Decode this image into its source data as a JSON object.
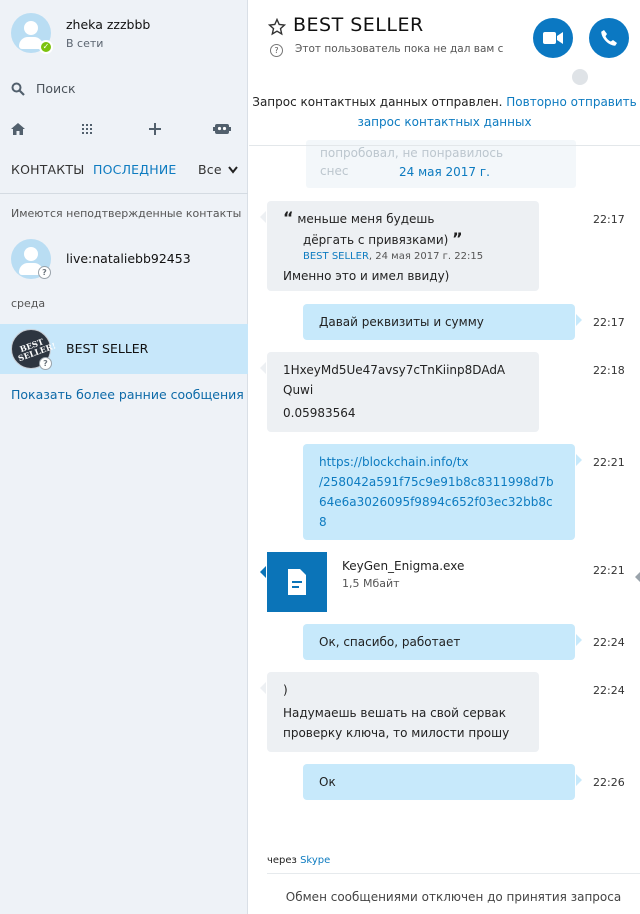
{
  "profile": {
    "name": "zheka zzzbbb",
    "status": "В сети"
  },
  "search": {
    "label": "Поиск"
  },
  "toolbar": {
    "home": "home-icon",
    "dialpad": "dialpad-icon",
    "add": "add-icon",
    "bot": "bot-icon"
  },
  "tabs": {
    "contacts": "КОНТАКТЫ",
    "recent": "ПОСЛЕДНИЕ",
    "filter": "Все"
  },
  "sidebar": {
    "unconfirmed_label": "Имеются неподтвержденные контакты",
    "contact1": "live:nataliebb92453",
    "day_label": "среда",
    "contact2": "BEST SELLER",
    "contact2_logo": "BEST SELLER!",
    "earlier": "Показать более ранние сообщения"
  },
  "chat": {
    "title": "BEST SELLER",
    "subtitle": "Этот пользователь пока не дал вам с",
    "notice_text": "Запрос контактных данных отправлен.",
    "notice_link1": "Повторно отправить",
    "notice_link2": "запрос контактных данных",
    "ghost_line1": "попробовал, не понравилось",
    "ghost_line2": "снес",
    "date": "24 мая 2017 г.",
    "messages": [
      {
        "quote_line1": "меньше меня будешь",
        "quote_line2": "дёргать с привязками)",
        "quote_author": "BEST SELLER",
        "quote_date": ", 24 мая 2017 г. 22:15",
        "text": "Именно это и имел ввиду)",
        "time": "22:17"
      },
      {
        "text": "Давай реквизиты и сумму",
        "time": "22:17"
      },
      {
        "line1": "1HxeyMd5Ue47avsy7cTnKiinp8DAdA",
        "line2": "Quwi",
        "line3": "0.05983564",
        "time": "22:18"
      },
      {
        "line1": "https://blockchain.info/tx",
        "line2": "/258042a591f75c9e91b8c8311998d7b",
        "line3": "64e6a3026095f9894c652f03ec32bb8c",
        "line4": "8",
        "time": "22:21"
      },
      {
        "file_name": "KeyGen_Enigma.exe",
        "file_size": "1,5 Мбайт",
        "time": "22:21"
      },
      {
        "text": "Ок, спасибо, работает",
        "time": "22:24"
      },
      {
        "line1": ")",
        "line2": "Надумаешь вешать на свой сервак",
        "line3": "проверку ключа, то милости прошу",
        "time": "22:24"
      },
      {
        "text": "Ок",
        "time": "22:26"
      }
    ],
    "via_label": "через",
    "via_app": "Skype",
    "blocked": "Обмен сообщениями отключен до принятия запроса"
  },
  "colors": {
    "accent": "#0b78c2",
    "selected": "#c7e7fa",
    "out_bubble": "#c7e9fb",
    "in_bubble": "#edf0f3",
    "online": "#7cc20d"
  }
}
